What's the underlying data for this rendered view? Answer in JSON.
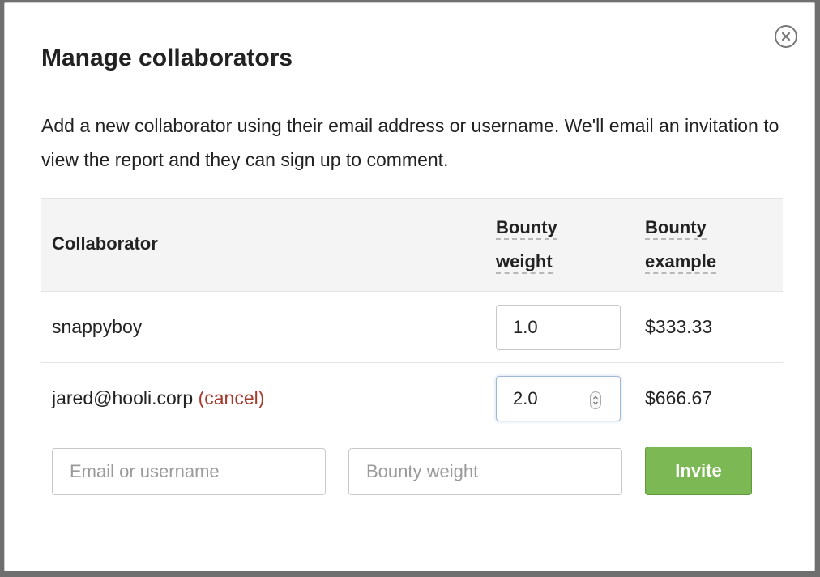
{
  "dialog": {
    "title": "Manage collaborators",
    "description": "Add a new collaborator using their email address or username. We'll email an invitation to view the report and they can sign up to comment.",
    "close_icon": "close-circle-icon"
  },
  "table": {
    "headers": {
      "collaborator": "Collaborator",
      "bounty_weight_line1": "Bounty",
      "bounty_weight_line2": "weight",
      "bounty_example_line1": "Bounty",
      "bounty_example_line2": "example"
    },
    "rows": [
      {
        "name": "snappyboy",
        "cancel_label": "",
        "weight": "1.0",
        "example": "$333.33"
      },
      {
        "name": "jared@hooli.corp",
        "cancel_label": "(cancel)",
        "weight": "2.0",
        "example": "$666.67"
      }
    ]
  },
  "invite_form": {
    "email_placeholder": "Email or username",
    "bounty_placeholder": "Bounty weight",
    "invite_label": "Invite"
  },
  "colors": {
    "invite_button": "#7cb954",
    "cancel_link": "#a33a2d",
    "header_background": "#f4f4f4"
  }
}
